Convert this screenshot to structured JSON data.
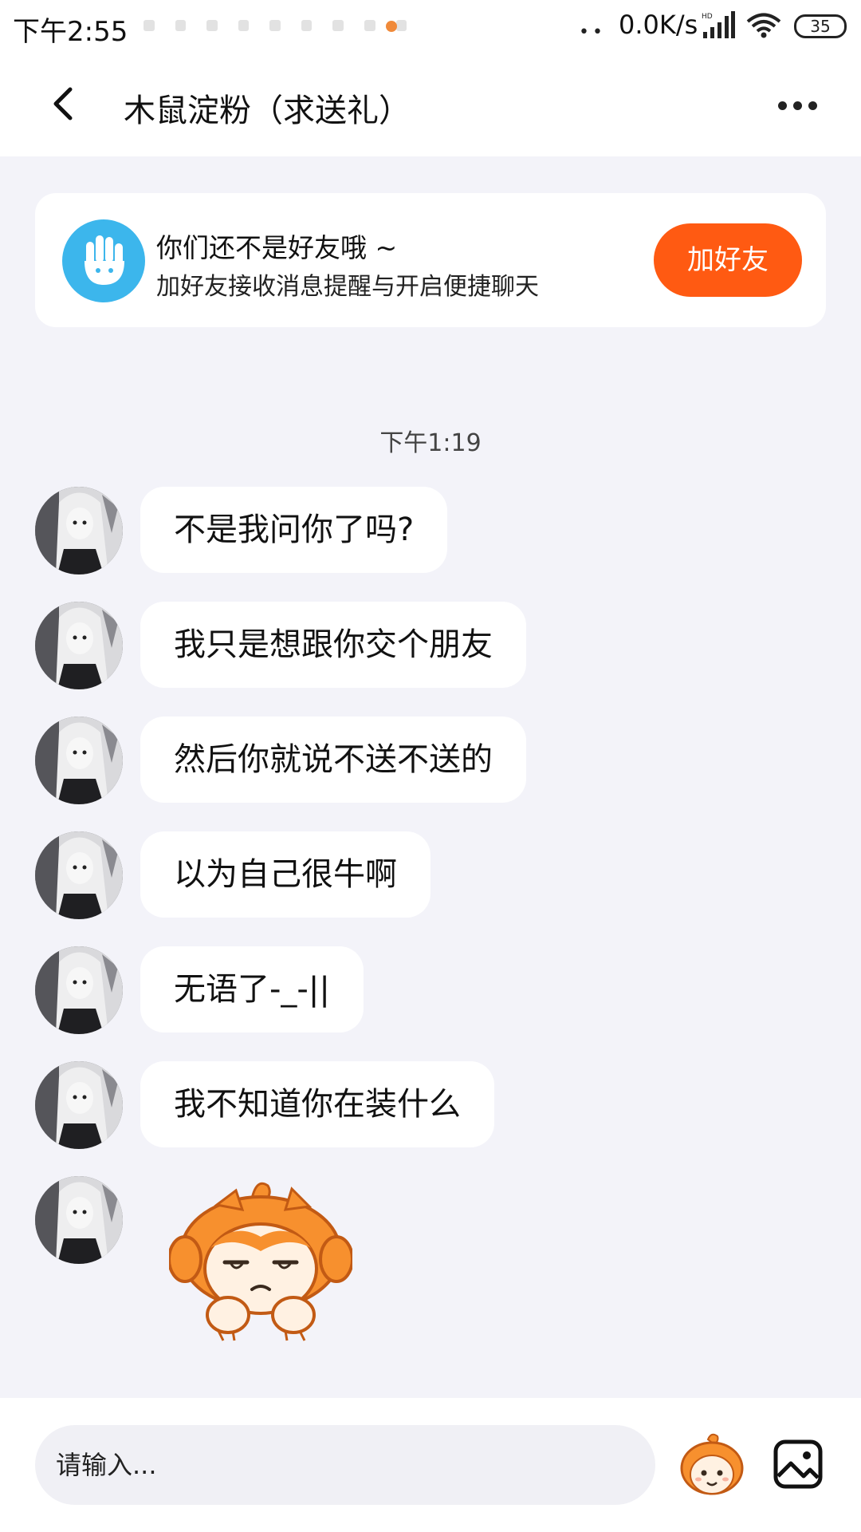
{
  "status_bar": {
    "time": "下午2:55",
    "network_speed": "0.0K/s",
    "battery": "35",
    "icons": [
      "signal-icon",
      "wifi-icon",
      "battery-icon"
    ]
  },
  "header": {
    "title": "木鼠淀粉（求送礼）",
    "back_icon": "chevron-left-icon",
    "more_icon": "more-dots-icon"
  },
  "friend_card": {
    "title": "你们还不是好友哦 ~",
    "subtitle": "加好友接收消息提醒与开启便捷聊天",
    "button_label": "加好友",
    "icon": "hand-wave-icon"
  },
  "chat": {
    "timestamp": "下午1:19",
    "messages": [
      {
        "text": "不是我问你了吗?"
      },
      {
        "text": "我只是想跟你交个朋友"
      },
      {
        "text": "然后你就说不送不送的"
      },
      {
        "text": "以为自己很牛啊"
      },
      {
        "text": "无语了-_-||"
      },
      {
        "text": "我不知道你在装什么"
      }
    ],
    "sticker": "unamused-mascot-sticker"
  },
  "input_bar": {
    "placeholder": "请输入...",
    "emoji_icon": "mascot-emoji-icon",
    "image_icon": "image-icon"
  },
  "colors": {
    "accent": "#ff5a12",
    "logo_blue": "#3cb6ec",
    "chat_background": "#f3f3f9",
    "bubble": "#ffffff"
  }
}
